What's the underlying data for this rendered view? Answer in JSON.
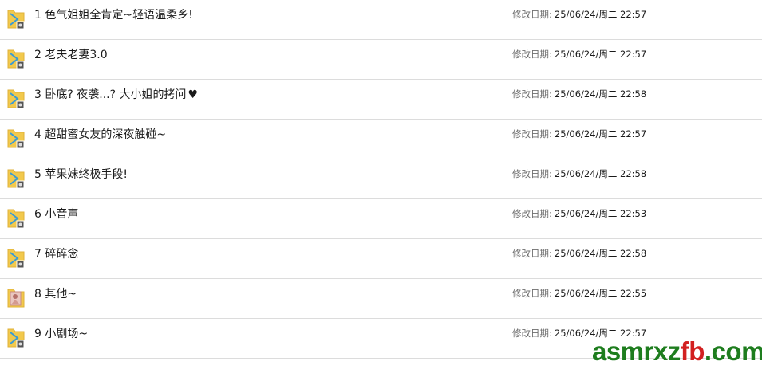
{
  "file_list": {
    "date_label": "修改日期:",
    "items": [
      {
        "name": "1 色气姐姐全肯定~轻语温柔乡!",
        "modified": "25/06/24/周二 22:57",
        "icon": "audio-folder-icon"
      },
      {
        "name": "2 老夫老妻3.0",
        "modified": "25/06/24/周二 22:57",
        "icon": "audio-folder-icon"
      },
      {
        "name": "3 卧底? 夜袭...? 大小姐的拷问",
        "modified": "25/06/24/周二 22:58",
        "icon": "audio-folder-icon",
        "suffix_icon": "heart-icon"
      },
      {
        "name": "4 超甜蜜女友的深夜触碰~",
        "modified": "25/06/24/周二 22:57",
        "icon": "audio-folder-icon"
      },
      {
        "name": "5 苹果妹终极手段!",
        "modified": "25/06/24/周二 22:58",
        "icon": "audio-folder-icon"
      },
      {
        "name": "6 小音声",
        "modified": "25/06/24/周二 22:53",
        "icon": "audio-folder-icon"
      },
      {
        "name": "7 碎碎念",
        "modified": "25/06/24/周二 22:58",
        "icon": "audio-folder-icon"
      },
      {
        "name": "8 其他~",
        "modified": "25/06/24/周二 22:55",
        "icon": "image-folder-icon"
      },
      {
        "name": "9 小剧场~",
        "modified": "25/06/24/周二 22:57",
        "icon": "audio-folder-icon"
      }
    ]
  },
  "watermark": {
    "part1": "asmrxz",
    "part2": "fb",
    "part3": ".com"
  },
  "colors": {
    "folder": "#f2c94c",
    "folder_dark": "#dfb13a",
    "play": "#3a9bd5",
    "watermark_green": "#1e7d1e",
    "watermark_red": "#d22020"
  }
}
